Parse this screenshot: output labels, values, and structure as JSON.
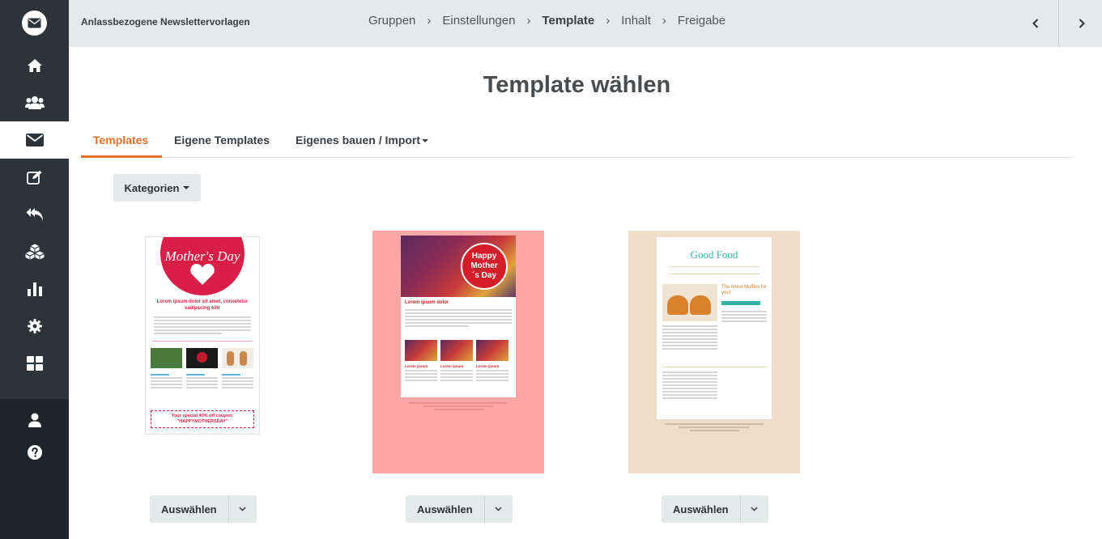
{
  "app": {
    "title": "Anlassbezogene Newslettervorlagen"
  },
  "breadcrumb": [
    {
      "label": "Gruppen"
    },
    {
      "label": "Einstellungen"
    },
    {
      "label": "Template"
    },
    {
      "label": "Inhalt"
    },
    {
      "label": "Freigabe"
    }
  ],
  "breadcrumb_current": "Template",
  "page": {
    "title": "Template wählen"
  },
  "tabs": [
    {
      "label": "Templates"
    },
    {
      "label": "Eigene Templates"
    },
    {
      "label": "Eigenes bauen / Import"
    }
  ],
  "category_button": {
    "label": "Kategorien"
  },
  "templates": [
    {
      "name": "mothers-day-white",
      "banner_text": "Mother's Day",
      "heading": "Lorem ipsum dolor sit amet, consetetur sadipscing elitr",
      "coupon_line1": "Your special 40% off coupon:",
      "coupon_code": "\"HAPPYMOTHERSDAY\"",
      "select_label": "Auswählen"
    },
    {
      "name": "mothers-day-pink",
      "badge_text": "Happy Mother´s Day",
      "heading": "Lorem ipsum dolor",
      "col_heading": "Lorem ipsum",
      "select_label": "Auswählen"
    },
    {
      "name": "good-food",
      "logo_text": "Good Food",
      "headline": "The finest Muffins for you!",
      "select_label": "Auswählen"
    }
  ],
  "colors": {
    "accent": "#e0702a",
    "sidebar": "#2c3339",
    "topbar": "#e4e9ea",
    "pink_bg": "#ffa6a6",
    "beige_bg": "#efdccb",
    "mothers_red": "#d91f47",
    "good_food_teal": "#33b3a6"
  },
  "icons": [
    "mail-icon",
    "home-icon",
    "users-icon",
    "envelope-icon",
    "edit-icon",
    "reply-icon",
    "cubes-icon",
    "bar-chart-icon",
    "gear-icon",
    "dashboard-icon",
    "user-icon",
    "help-icon",
    "chevron-left-icon",
    "chevron-right-icon",
    "chevron-down-icon"
  ]
}
